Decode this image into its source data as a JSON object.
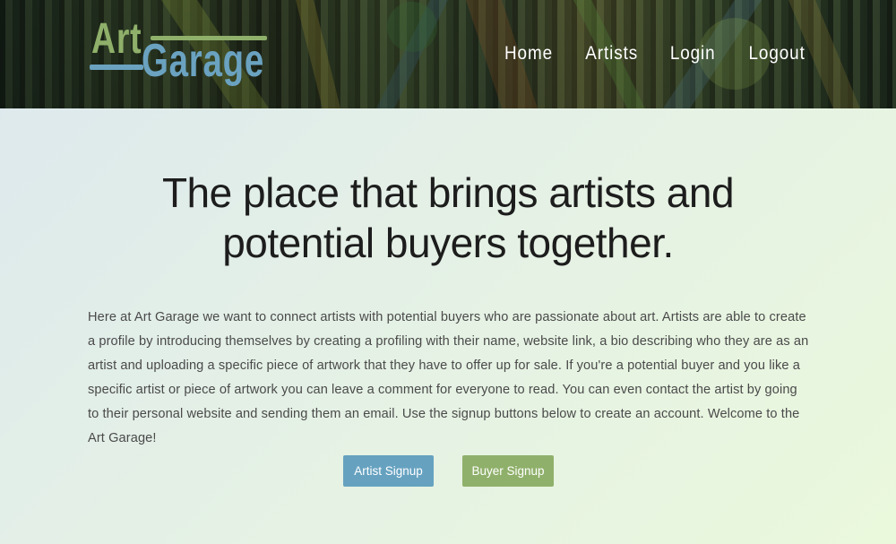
{
  "header": {
    "logo": {
      "art": "Art",
      "garage": "Garage"
    },
    "nav": [
      "Home",
      "Artists",
      "Login",
      "Logout"
    ]
  },
  "hero": {
    "headline": "The place that brings artists and potential buyers together.",
    "intro": "Here at Art Garage we want to connect artists with potential buyers who are passionate about art. Artists are able to create a profile by introducing themselves by creating a profiling with their name, website link, a bio describing who they are as an artist and uploading a specific piece of artwork that they have to offer up for sale. If you're a potential buyer and you like a specific artist or piece of artwork you can leave a comment for everyone to read. You can even contact the artist by going to their personal website and sending them an email. Use the signup buttons below to create an account. Welcome to the Art Garage!",
    "buttons": {
      "artist": "Artist Signup",
      "buyer": "Buyer Signup"
    }
  },
  "colors": {
    "logo_green": "#8fb06a",
    "logo_blue": "#6aa2c0",
    "artist_button": "#66a2c0",
    "buyer_button": "#8fb06a",
    "headline_text": "#1d1d1d",
    "body_text": "#4a4a4a"
  }
}
